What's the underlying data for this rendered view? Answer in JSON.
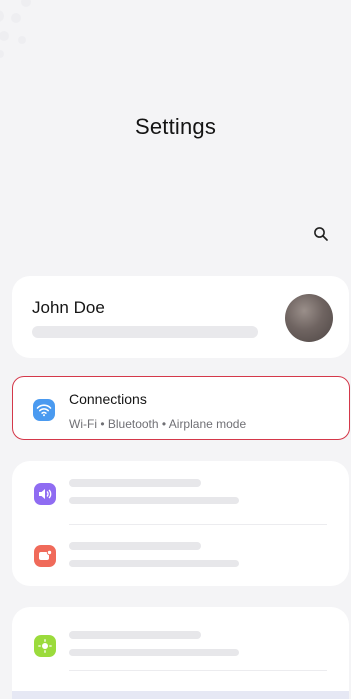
{
  "header": {
    "title": "Settings"
  },
  "search": {
    "icon": "search-icon"
  },
  "profile": {
    "name": "John Doe",
    "avatar": "avatar"
  },
  "connections": {
    "title": "Connections",
    "subtitle": "Wi-Fi  •  Bluetooth  •  Airplane mode",
    "icon": "wifi-icon",
    "icon_color": "#4a9af0",
    "highlight_color": "#d4384a"
  },
  "group1": {
    "items": [
      {
        "icon": "sound-icon",
        "icon_color": "#8f6cf2"
      },
      {
        "icon": "notification-icon",
        "icon_color": "#f06a5a"
      }
    ]
  },
  "group2": {
    "items": [
      {
        "icon": "display-icon",
        "icon_color": "#9bdb3c"
      }
    ]
  }
}
